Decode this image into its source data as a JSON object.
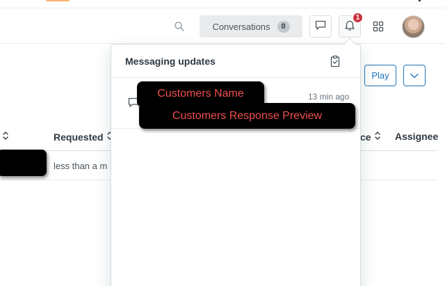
{
  "header": {
    "conversations_label": "Conversations",
    "conversations_count": "0",
    "notification_badge": "1",
    "icons": [
      "search-icon",
      "chat-icon",
      "bell-icon",
      "apps-grid-icon",
      "avatar"
    ]
  },
  "toolbar": {
    "play_label": "Play"
  },
  "table": {
    "columns": [
      "Requested",
      "ce",
      "Assignee"
    ],
    "rows": [
      {
        "requested": "less than a m"
      }
    ]
  },
  "panel": {
    "title": "Messaging updates",
    "items": [
      {
        "name": "Customers Name",
        "preview": "Customers Response Preview",
        "time": "13 min ago"
      }
    ]
  },
  "colors": {
    "accent": "#1f73b7",
    "badge": "#cc3340",
    "annotation_text": "#f04f4f"
  }
}
